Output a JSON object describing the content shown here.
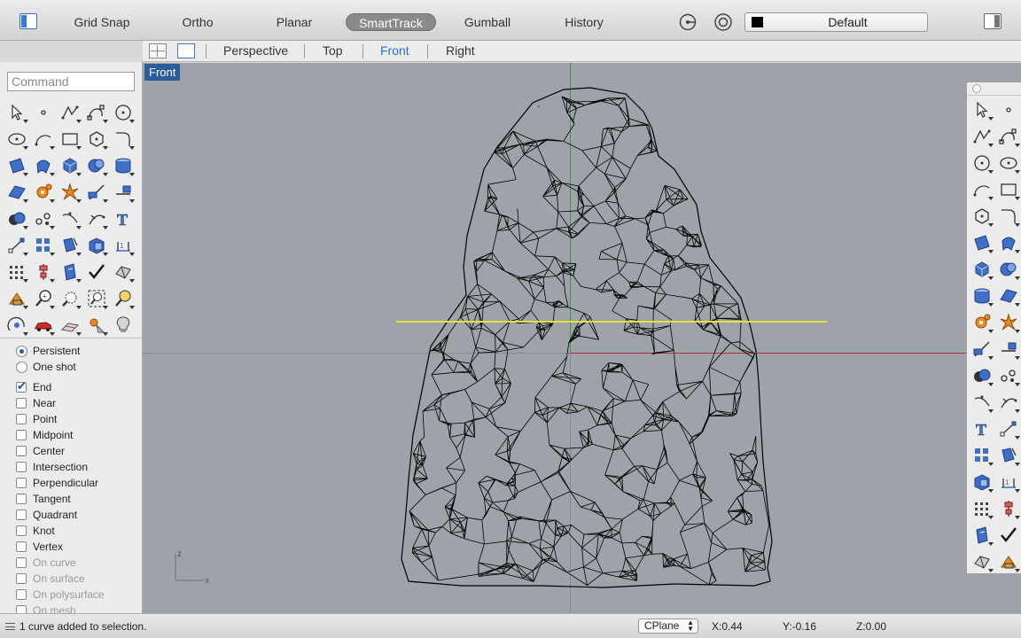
{
  "toolbar": {
    "modes": [
      {
        "label": "Grid Snap",
        "active": false
      },
      {
        "label": "Ortho",
        "active": false
      },
      {
        "label": "Planar",
        "active": false
      },
      {
        "label": "SmartTrack",
        "active": true
      },
      {
        "label": "Gumball",
        "active": false
      },
      {
        "label": "History",
        "active": false
      }
    ],
    "layer": {
      "name": "Default",
      "color": "#000000"
    }
  },
  "viewport_tabs": {
    "tabs": [
      "Perspective",
      "Top",
      "Front",
      "Right"
    ],
    "active": "Front"
  },
  "command": {
    "placeholder": "Command",
    "value": ""
  },
  "osnap": {
    "modes": [
      {
        "label": "Persistent",
        "selected": true
      },
      {
        "label": "One shot",
        "selected": false
      }
    ],
    "items": [
      {
        "label": "End",
        "checked": true,
        "enabled": true
      },
      {
        "label": "Near",
        "checked": false,
        "enabled": true
      },
      {
        "label": "Point",
        "checked": false,
        "enabled": true
      },
      {
        "label": "Midpoint",
        "checked": false,
        "enabled": true
      },
      {
        "label": "Center",
        "checked": false,
        "enabled": true
      },
      {
        "label": "Intersection",
        "checked": false,
        "enabled": true
      },
      {
        "label": "Perpendicular",
        "checked": false,
        "enabled": true
      },
      {
        "label": "Tangent",
        "checked": false,
        "enabled": true
      },
      {
        "label": "Quadrant",
        "checked": false,
        "enabled": true
      },
      {
        "label": "Knot",
        "checked": false,
        "enabled": true
      },
      {
        "label": "Vertex",
        "checked": false,
        "enabled": true
      },
      {
        "label": "On curve",
        "checked": false,
        "enabled": false
      },
      {
        "label": "On surface",
        "checked": false,
        "enabled": false
      },
      {
        "label": "On polysurface",
        "checked": false,
        "enabled": false
      },
      {
        "label": "On mesh",
        "checked": false,
        "enabled": false
      }
    ]
  },
  "viewport": {
    "title": "Front",
    "axis_z": "z",
    "axis_x": "x",
    "colors": {
      "background": "#9ea2a9",
      "x_axis": "#a03535",
      "y_axis": "#3a9a3a",
      "mesh": "#000000",
      "highlight": "#e3e33a"
    }
  },
  "left_tools": [
    "select-icon",
    "point-icon",
    "polyline-icon",
    "curve-icon",
    "circle-icon",
    "ellipse-icon",
    "arc-icon",
    "rectangle-icon",
    "polygon-icon",
    "fillet-curve-icon",
    "surface-from-points-icon",
    "loft-icon",
    "box-icon",
    "sphere-icon",
    "cylinder-icon",
    "surface-icon",
    "gear-icon",
    "explode-icon",
    "trim-icon",
    "split-icon",
    "boolean-icon",
    "points-on-icon",
    "curve-edit-icon",
    "extend-icon",
    "text-icon",
    "move-icon",
    "group-icon",
    "array-icon",
    "block-icon",
    "dimension-icon",
    "grid-array-icon",
    "align-icon",
    "properties-icon",
    "check-icon",
    "hide-icon",
    "paint-icon",
    "zoom-icon",
    "zoom-window-icon",
    "zoom-extents-icon",
    "zoom-selected-icon",
    "render-icon",
    "car-icon",
    "plane-icon",
    "light-icon",
    "bulb-icon"
  ],
  "right_tools": [
    "select-icon",
    "point-icon",
    "polyline-icon",
    "curve-icon",
    "circle-icon",
    "ellipse-icon",
    "arc-icon",
    "rectangle-icon",
    "polygon-icon",
    "fillet-curve-icon",
    "surface-from-points-icon",
    "loft-icon",
    "box-icon",
    "sphere-icon",
    "cylinder-icon",
    "surface-icon",
    "gear-icon",
    "explode-icon",
    "trim-icon",
    "split-icon",
    "boolean-icon",
    "points-on-icon",
    "curve-edit-icon",
    "extend-icon",
    "text-icon",
    "move-icon",
    "group-icon",
    "array-icon",
    "block-icon",
    "dimension-icon",
    "grid-array-icon",
    "align-icon",
    "properties-icon",
    "check-icon",
    "hide-icon",
    "paint-icon"
  ],
  "status": {
    "message": "1 curve added to selection.",
    "cplane": "CPlane",
    "x": "X:0.44",
    "y": "Y:-0.16",
    "z": "Z:0.00"
  }
}
